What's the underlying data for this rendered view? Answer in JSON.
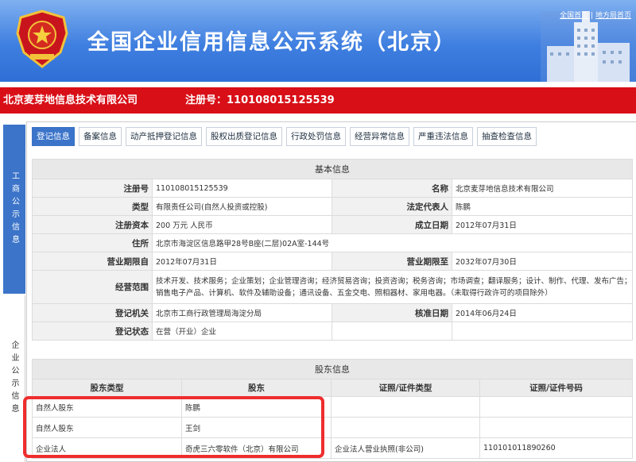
{
  "header": {
    "title": "全国企业信用信息公示系统（北京）",
    "links": [
      "全国首页",
      "地方局首页"
    ],
    "link_separator": "|"
  },
  "company_bar": {
    "name": "北京麦芽地信息技术有限公司",
    "reg_label": "注册号：",
    "reg_no": "110108015125539"
  },
  "side_tabs": [
    "工商公示信息",
    "企业公示信息"
  ],
  "tabs": [
    {
      "label": "登记信息",
      "active": true
    },
    {
      "label": "备案信息",
      "active": false
    },
    {
      "label": "动产抵押登记信息",
      "active": false
    },
    {
      "label": "股权出质登记信息",
      "active": false
    },
    {
      "label": "行政处罚信息",
      "active": false
    },
    {
      "label": "经营异常信息",
      "active": false
    },
    {
      "label": "严重违法信息",
      "active": false
    },
    {
      "label": "抽查检查信息",
      "active": false
    }
  ],
  "basic_info": {
    "title": "基本信息",
    "reg_no_label": "注册号",
    "reg_no": "110108015125539",
    "name_label": "名称",
    "name": "北京麦芽地信息技术有限公司",
    "type_label": "类型",
    "type": "有限责任公司(自然人投资或控股)",
    "legal_rep_label": "法定代表人",
    "legal_rep": "陈鹏",
    "capital_label": "注册资本",
    "capital": "200 万元 人民币",
    "est_date_label": "成立日期",
    "est_date": "2012年07月31日",
    "address_label": "住所",
    "address": "北京市海淀区信息路甲28号B座(二层)02A室-144号",
    "term_from_label": "营业期限自",
    "term_from": "2012年07月31日",
    "term_to_label": "营业期限至",
    "term_to": "2032年07月30日",
    "scope_label": "经营范围",
    "scope": "技术开发、技术服务；企业策划；企业管理咨询；经济贸易咨询；投资咨询；税务咨询；市场调查；翻译服务；设计、制作、代理、发布广告；销售电子产品、计算机、软件及辅助设备；通讯设备、五金交电、照相器材、家用电器。（未取得行政许可的项目除外）",
    "authority_label": "登记机关",
    "authority": "北京市工商行政管理局海淀分局",
    "approve_date_label": "核准日期",
    "approve_date": "2014年06月24日",
    "status_label": "登记状态",
    "status": "在营（开业）企业"
  },
  "shareholders": {
    "title": "股东信息",
    "columns": [
      "股东类型",
      "股东",
      "证照/证件类型",
      "证照/证件号码"
    ],
    "rows": [
      [
        "自然人股东",
        "陈鹏",
        "",
        ""
      ],
      [
        "自然人股东",
        "王剑",
        "",
        ""
      ],
      [
        "企业法人",
        "奇虎三六零软件（北京）有限公司",
        "企业法人营业执照(非公司)",
        "110101011890260"
      ]
    ]
  },
  "colors": {
    "header_blue": "#3f7fe0",
    "company_bar_red": "#d80f17",
    "tab_active": "#3b74c9",
    "highlight_red": "#ef2d2d"
  }
}
